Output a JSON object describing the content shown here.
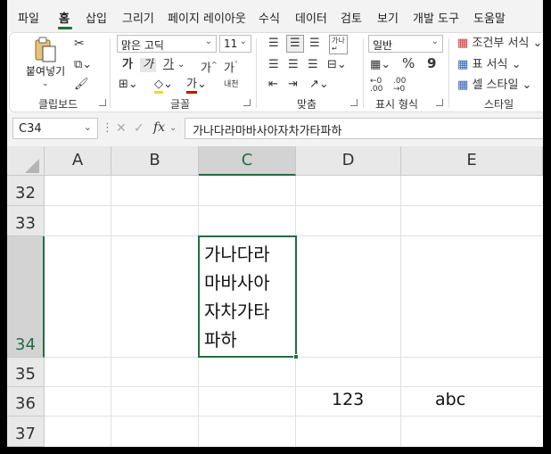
{
  "menu": {
    "tabs": [
      {
        "label": "파일"
      },
      {
        "label": "홈"
      },
      {
        "label": "삽입"
      },
      {
        "label": "그리기"
      },
      {
        "label": "페이지 레이아웃"
      },
      {
        "label": "수식"
      },
      {
        "label": "데이터"
      },
      {
        "label": "검토"
      },
      {
        "label": "보기"
      },
      {
        "label": "개발 도구"
      },
      {
        "label": "도움말"
      }
    ],
    "active_tab": "홈"
  },
  "ribbon": {
    "clipboard": {
      "label": "클립보드",
      "paste_label": "붙여넣기"
    },
    "font": {
      "label": "글꼴",
      "font_name": "맑은 고딕",
      "font_size": "11",
      "bold": "가",
      "italic": "가",
      "underline": "가",
      "grow": "가",
      "shrink": "가",
      "font_color_glyph": "가",
      "phonetic": "내천"
    },
    "alignment": {
      "label": "맞춤",
      "wrap_glyph": "가나"
    },
    "number": {
      "label": "표시 형식",
      "format": "일반",
      "percent": "%",
      "comma": "9"
    },
    "styles": {
      "label": "스타일",
      "conditional": "조건부 서식",
      "table": "표 서식",
      "cell": "셀 스타일"
    }
  },
  "formula_bar": {
    "name_box": "C34",
    "fx": "fx",
    "content": "가나다라마바사아자차가타파하"
  },
  "sheet": {
    "columns": [
      "A",
      "B",
      "C",
      "D",
      "E"
    ],
    "selected_column": "C",
    "rows": [
      "32",
      "33",
      "34",
      "35",
      "36",
      "37"
    ],
    "selected_row": "34",
    "c34_lines": [
      "가나다라",
      "마바사아",
      "자차가타",
      "파하"
    ],
    "d36": "123",
    "e36": "abc"
  },
  "colors": {
    "accent": "#1f6e43",
    "header_bg": "#e8e8e8",
    "selected_header_bg": "#d3d3d3"
  }
}
